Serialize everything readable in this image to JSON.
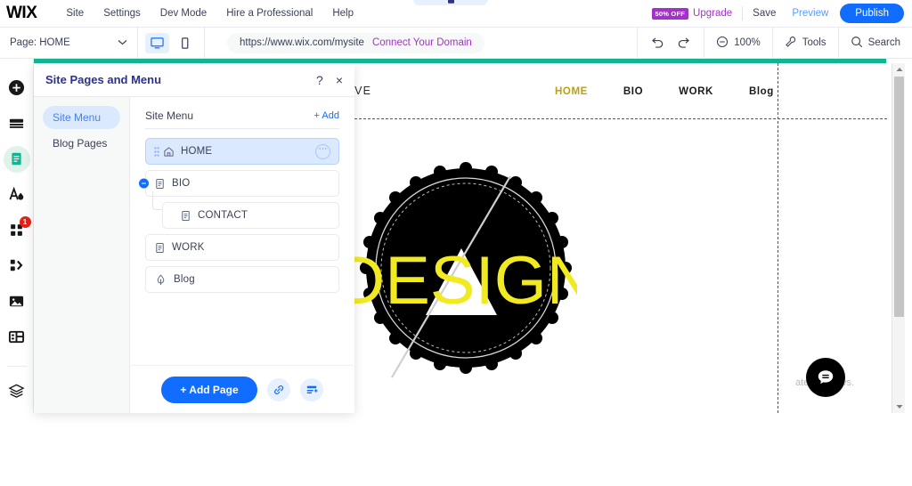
{
  "topbar": {
    "logo": "WIX",
    "menu": [
      {
        "label": "Site",
        "name": "topmenu-site"
      },
      {
        "label": "Settings",
        "name": "topmenu-settings"
      },
      {
        "label": "Dev Mode",
        "name": "topmenu-dev-mode"
      },
      {
        "label": "Hire a Professional",
        "name": "topmenu-hire-professional"
      },
      {
        "label": "Help",
        "name": "topmenu-help"
      }
    ],
    "discount_badge": "50% OFF",
    "upgrade": "Upgrade",
    "save": "Save",
    "preview": "Preview",
    "publish": "Publish"
  },
  "toolbar": {
    "page_selector": "Page: HOME",
    "url": "https://www.wix.com/mysite",
    "connect_domain": "Connect Your Domain",
    "zoom": "100%",
    "tools": "Tools",
    "search": "Search",
    "device_desktop": "desktop-view",
    "device_mobile": "mobile-view"
  },
  "left_rail": [
    {
      "name": "add-elements-icon",
      "badge": ""
    },
    {
      "name": "sections-icon",
      "badge": ""
    },
    {
      "name": "pages-icon",
      "badge": ""
    },
    {
      "name": "theme-manager-icon",
      "badge": ""
    },
    {
      "name": "apps-market-icon",
      "badge": "1"
    },
    {
      "name": "blocks-icon",
      "badge": ""
    },
    {
      "name": "media-manager-icon",
      "badge": ""
    },
    {
      "name": "content-manager-icon",
      "badge": ""
    },
    {
      "name": "layers-icon",
      "badge": ""
    }
  ],
  "panel": {
    "title": "Site Pages and Menu",
    "help_icon": "?",
    "close_icon": "×",
    "tabs": [
      {
        "label": "Site Menu",
        "active": true
      },
      {
        "label": "Blog Pages",
        "active": false
      }
    ],
    "list_header": "Site Menu",
    "add_label": "+ Add",
    "pages": [
      {
        "label": "HOME",
        "icon": "home-icon",
        "selected": true,
        "child": false,
        "has_more": true,
        "has_collapse": false
      },
      {
        "label": "BIO",
        "icon": "page-icon",
        "selected": false,
        "child": false,
        "has_more": false,
        "has_collapse": true
      },
      {
        "label": "CONTACT",
        "icon": "page-icon",
        "selected": false,
        "child": true,
        "has_more": false,
        "has_collapse": false
      },
      {
        "label": "WORK",
        "icon": "page-icon",
        "selected": false,
        "child": false,
        "has_more": false,
        "has_collapse": false
      },
      {
        "label": "Blog",
        "icon": "blog-pen-icon",
        "selected": false,
        "child": false,
        "has_more": false,
        "has_collapse": false
      }
    ],
    "add_page_button": "+ Add Page",
    "link_button": "add-link-icon",
    "dropdown_button": "add-dropdown-icon"
  },
  "canvas": {
    "brand_text": "ATIVE",
    "nav": [
      {
        "label": "HOME",
        "active": true
      },
      {
        "label": "BIO",
        "active": false
      },
      {
        "label": "WORK",
        "active": false
      },
      {
        "label": "Blog",
        "active": false
      }
    ],
    "logo_text": "DESIGN",
    "logo_text_color": "#f2ea21",
    "logo_bg_color": "#000000",
    "chat_icon": "chat-bubble-icon",
    "watermark": "ate Windows."
  },
  "colors": {
    "accent_blue": "#116dff",
    "purple": "#a333c8",
    "green_bar": "#12b390",
    "active_nav": "#b9a20b"
  }
}
